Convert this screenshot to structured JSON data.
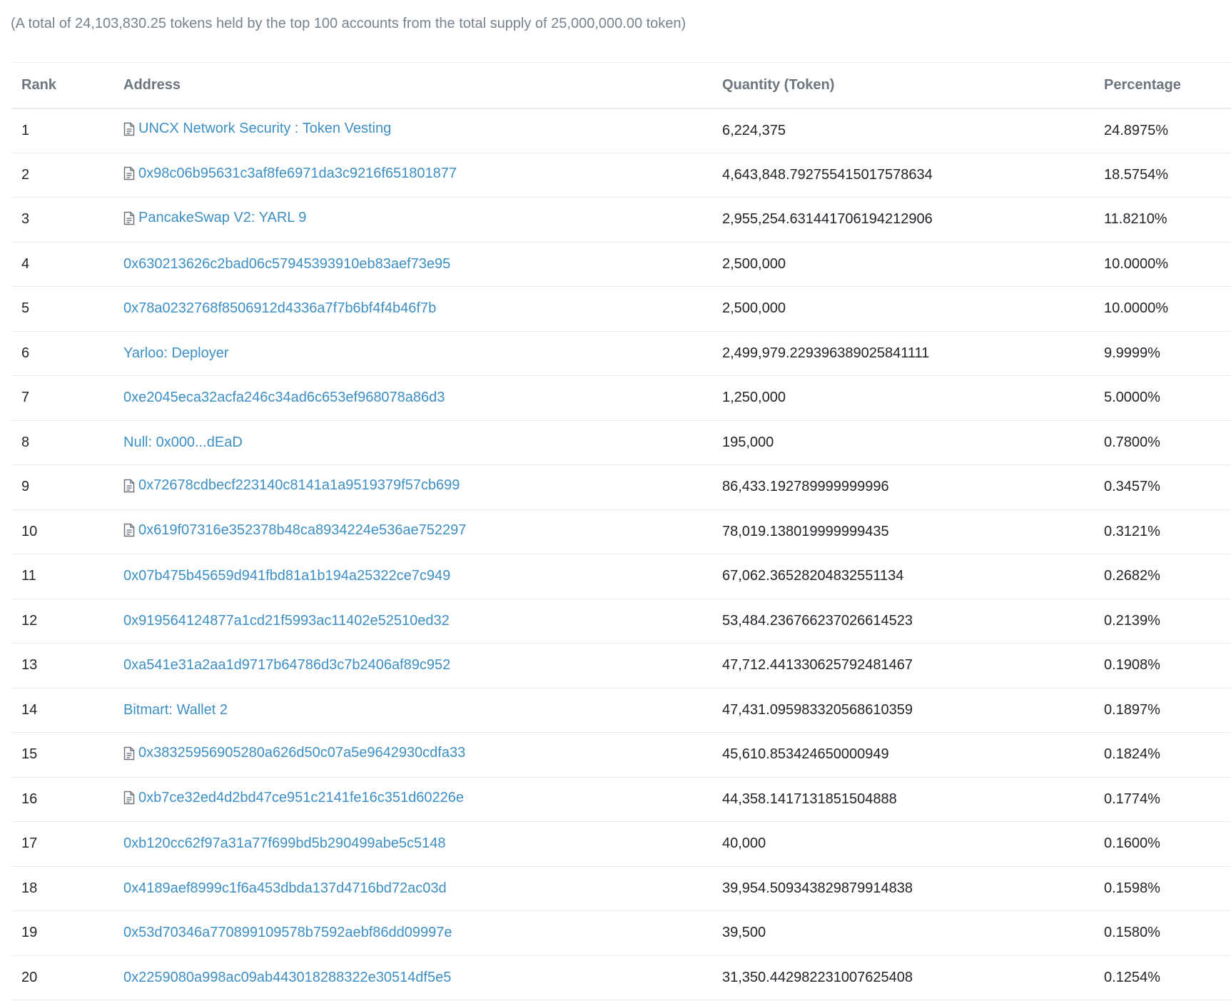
{
  "summary": "(A total of 24,103,830.25 tokens held by the top 100 accounts from the total supply of 25,000,000.00 token)",
  "columns": {
    "rank": "Rank",
    "address": "Address",
    "quantity": "Quantity (Token)",
    "percentage": "Percentage"
  },
  "link_color": "#3d8fc4",
  "rows": [
    {
      "rank": "1",
      "address": "UNCX Network Security : Token Vesting",
      "contract": true,
      "icon": "document-icon",
      "quantity": "6,224,375",
      "percentage": "24.8975%"
    },
    {
      "rank": "2",
      "address": "0x98c06b95631c3af8fe6971da3c9216f651801877",
      "contract": true,
      "icon": "document-icon",
      "quantity": "4,643,848.792755415017578634",
      "percentage": "18.5754%"
    },
    {
      "rank": "3",
      "address": "PancakeSwap V2: YARL 9",
      "contract": true,
      "icon": "document-icon",
      "quantity": "2,955,254.631441706194212906",
      "percentage": "11.8210%"
    },
    {
      "rank": "4",
      "address": "0x630213626c2bad06c57945393910eb83aef73e95",
      "contract": false,
      "quantity": "2,500,000",
      "percentage": "10.0000%"
    },
    {
      "rank": "5",
      "address": "0x78a0232768f8506912d4336a7f7b6bf4f4b46f7b",
      "contract": false,
      "quantity": "2,500,000",
      "percentage": "10.0000%"
    },
    {
      "rank": "6",
      "address": "Yarloo: Deployer",
      "contract": false,
      "quantity": "2,499,979.229396389025841111",
      "percentage": "9.9999%"
    },
    {
      "rank": "7",
      "address": "0xe2045eca32acfa246c34ad6c653ef968078a86d3",
      "contract": false,
      "quantity": "1,250,000",
      "percentage": "5.0000%"
    },
    {
      "rank": "8",
      "address": "Null: 0x000...dEaD",
      "contract": false,
      "quantity": "195,000",
      "percentage": "0.7800%"
    },
    {
      "rank": "9",
      "address": "0x72678cdbecf223140c8141a1a9519379f57cb699",
      "contract": true,
      "icon": "document-icon",
      "quantity": "86,433.192789999999996",
      "percentage": "0.3457%"
    },
    {
      "rank": "10",
      "address": "0x619f07316e352378b48ca8934224e536ae752297",
      "contract": true,
      "icon": "document-icon",
      "quantity": "78,019.138019999999435",
      "percentage": "0.3121%"
    },
    {
      "rank": "11",
      "address": "0x07b475b45659d941fbd81a1b194a25322ce7c949",
      "contract": false,
      "quantity": "67,062.36528204832551134",
      "percentage": "0.2682%"
    },
    {
      "rank": "12",
      "address": "0x919564124877a1cd21f5993ac11402e52510ed32",
      "contract": false,
      "quantity": "53,484.236766237026614523",
      "percentage": "0.2139%"
    },
    {
      "rank": "13",
      "address": "0xa541e31a2aa1d9717b64786d3c7b2406af89c952",
      "contract": false,
      "quantity": "47,712.441330625792481467",
      "percentage": "0.1908%"
    },
    {
      "rank": "14",
      "address": "Bitmart: Wallet 2",
      "contract": false,
      "quantity": "47,431.095983320568610359",
      "percentage": "0.1897%"
    },
    {
      "rank": "15",
      "address": "0x38325956905280a626d50c07a5e9642930cdfa33",
      "contract": true,
      "icon": "document-icon",
      "quantity": "45,610.853424650000949",
      "percentage": "0.1824%"
    },
    {
      "rank": "16",
      "address": "0xb7ce32ed4d2bd47ce951c2141fe16c351d60226e",
      "contract": true,
      "icon": "document-icon",
      "quantity": "44,358.1417131851504888",
      "percentage": "0.1774%"
    },
    {
      "rank": "17",
      "address": "0xb120cc62f97a31a77f699bd5b290499abe5c5148",
      "contract": false,
      "quantity": "40,000",
      "percentage": "0.1600%"
    },
    {
      "rank": "18",
      "address": "0x4189aef8999c1f6a453dbda137d4716bd72ac03d",
      "contract": false,
      "quantity": "39,954.509343829879914838",
      "percentage": "0.1598%"
    },
    {
      "rank": "19",
      "address": "0x53d70346a770899109578b7592aebf86dd09997e",
      "contract": false,
      "quantity": "39,500",
      "percentage": "0.1580%"
    },
    {
      "rank": "20",
      "address": "0x2259080a998ac09ab443018288322e30514df5e5",
      "contract": false,
      "quantity": "31,350.442982231007625408",
      "percentage": "0.1254%"
    }
  ]
}
